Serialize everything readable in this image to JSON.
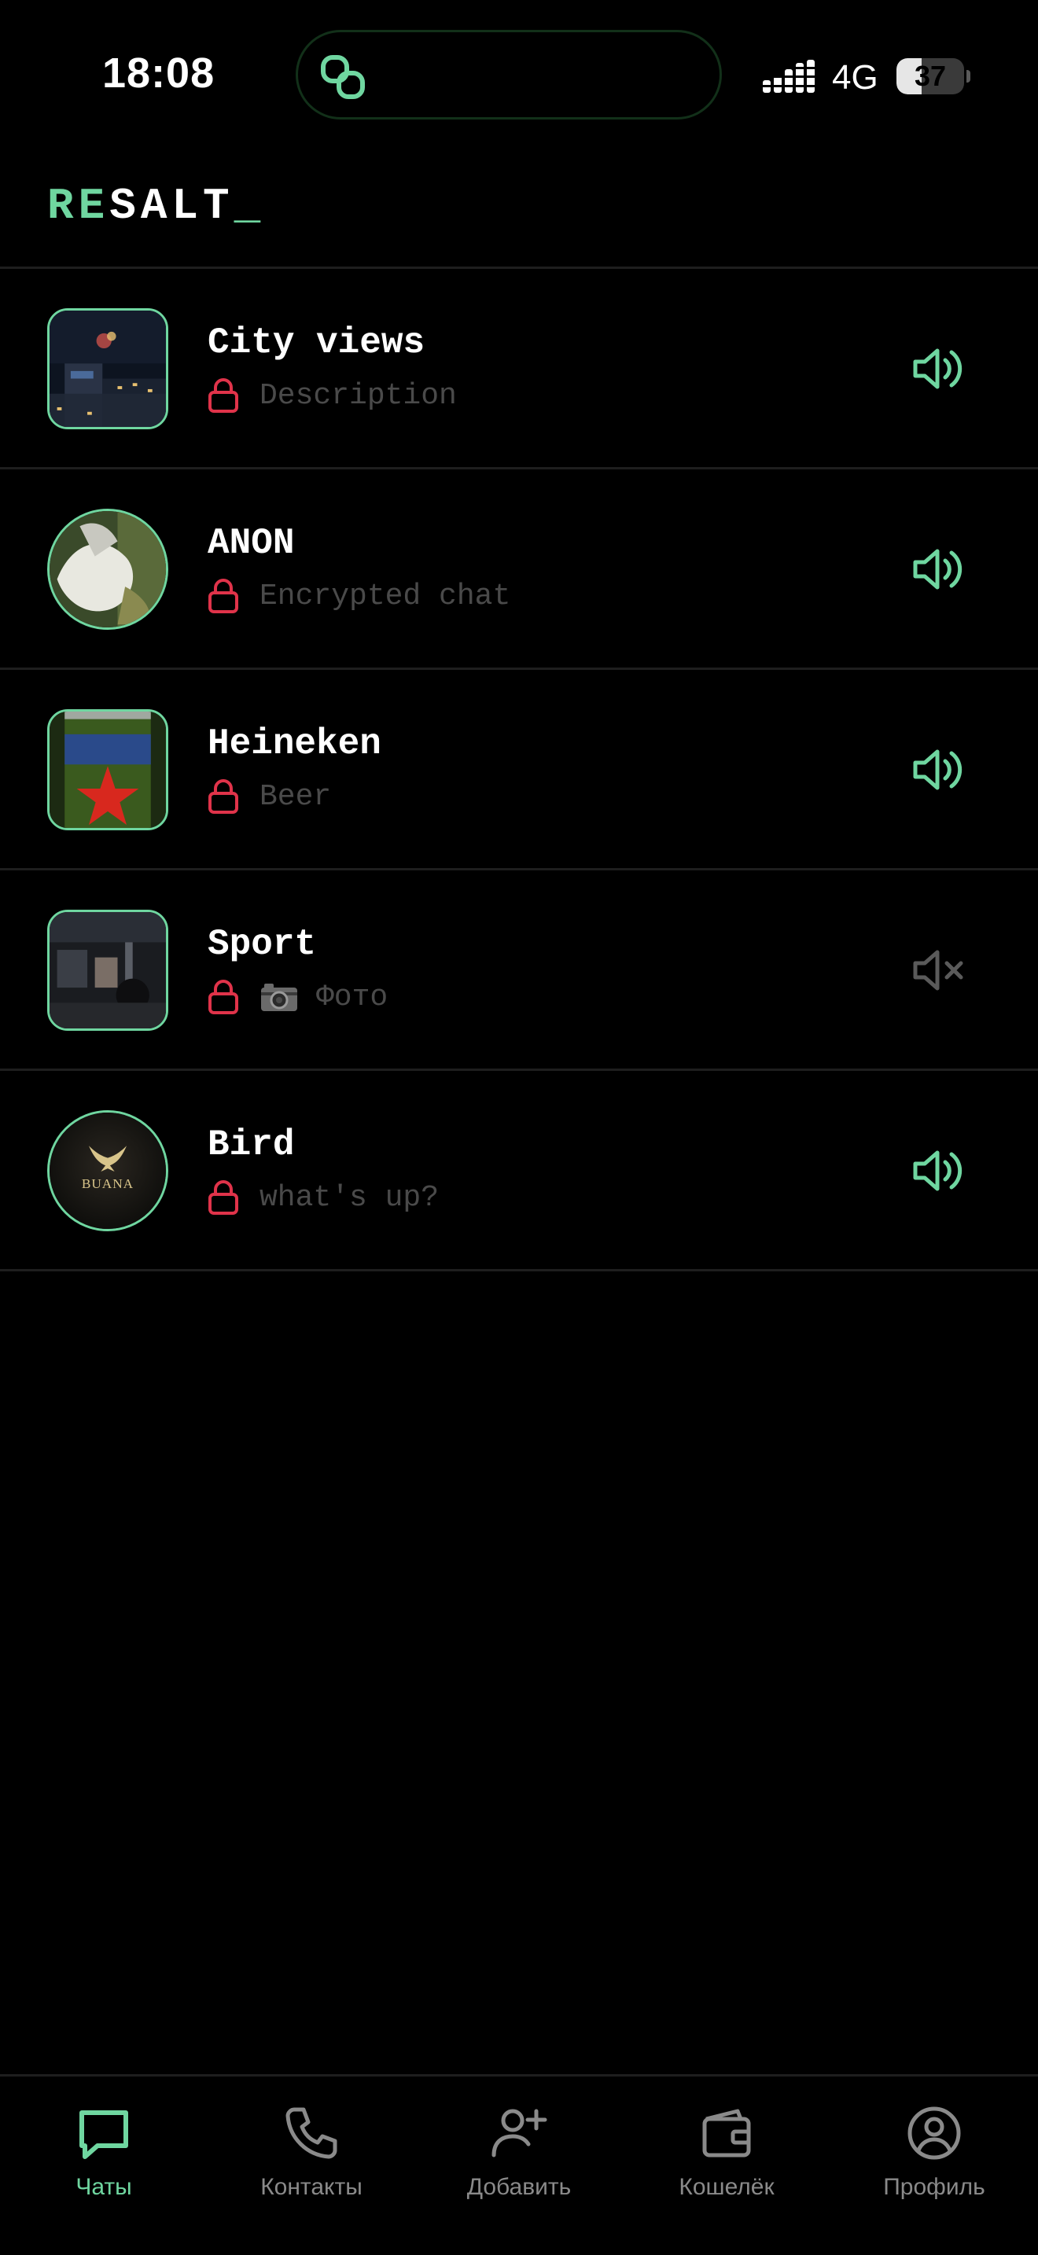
{
  "colors": {
    "accent": "#6fd6a0",
    "lock": "#e0334a",
    "muted": "#5a5a5a",
    "background": "#000000"
  },
  "status_bar": {
    "time": "18:08",
    "network": "4G",
    "battery_level": "37",
    "battery_fraction": 0.37
  },
  "header": {
    "logo_accent": "RE",
    "logo_main": "SALT",
    "logo_cursor": "_"
  },
  "chats": [
    {
      "title": "City views",
      "preview": "Description",
      "sound": "on",
      "avatar_shape": "square",
      "avatar": "city-night-photo"
    },
    {
      "title": "ANON",
      "preview": "Encrypted chat",
      "sound": "on",
      "avatar_shape": "round",
      "avatar": "abstract-photo"
    },
    {
      "title": "Heineken",
      "preview": "Beer",
      "sound": "on",
      "avatar_shape": "square",
      "avatar": "beer-can-photo"
    },
    {
      "title": "Sport",
      "preview": "Фото",
      "preview_icon": "camera-icon",
      "sound": "muted",
      "avatar_shape": "square",
      "avatar": "gym-photo"
    },
    {
      "title": "Bird",
      "preview": "what's up?",
      "sound": "on",
      "avatar_shape": "round",
      "avatar": "buana-logo",
      "avatar_text": "BUANA"
    }
  ],
  "tabs": [
    {
      "label": "Чаты",
      "icon": "chat-bubble-icon",
      "active": true
    },
    {
      "label": "Контакты",
      "icon": "phone-icon",
      "active": false
    },
    {
      "label": "Добавить",
      "icon": "add-user-icon",
      "active": false
    },
    {
      "label": "Кошелёк",
      "icon": "wallet-icon",
      "active": false
    },
    {
      "label": "Профиль",
      "icon": "profile-icon",
      "active": false
    }
  ]
}
